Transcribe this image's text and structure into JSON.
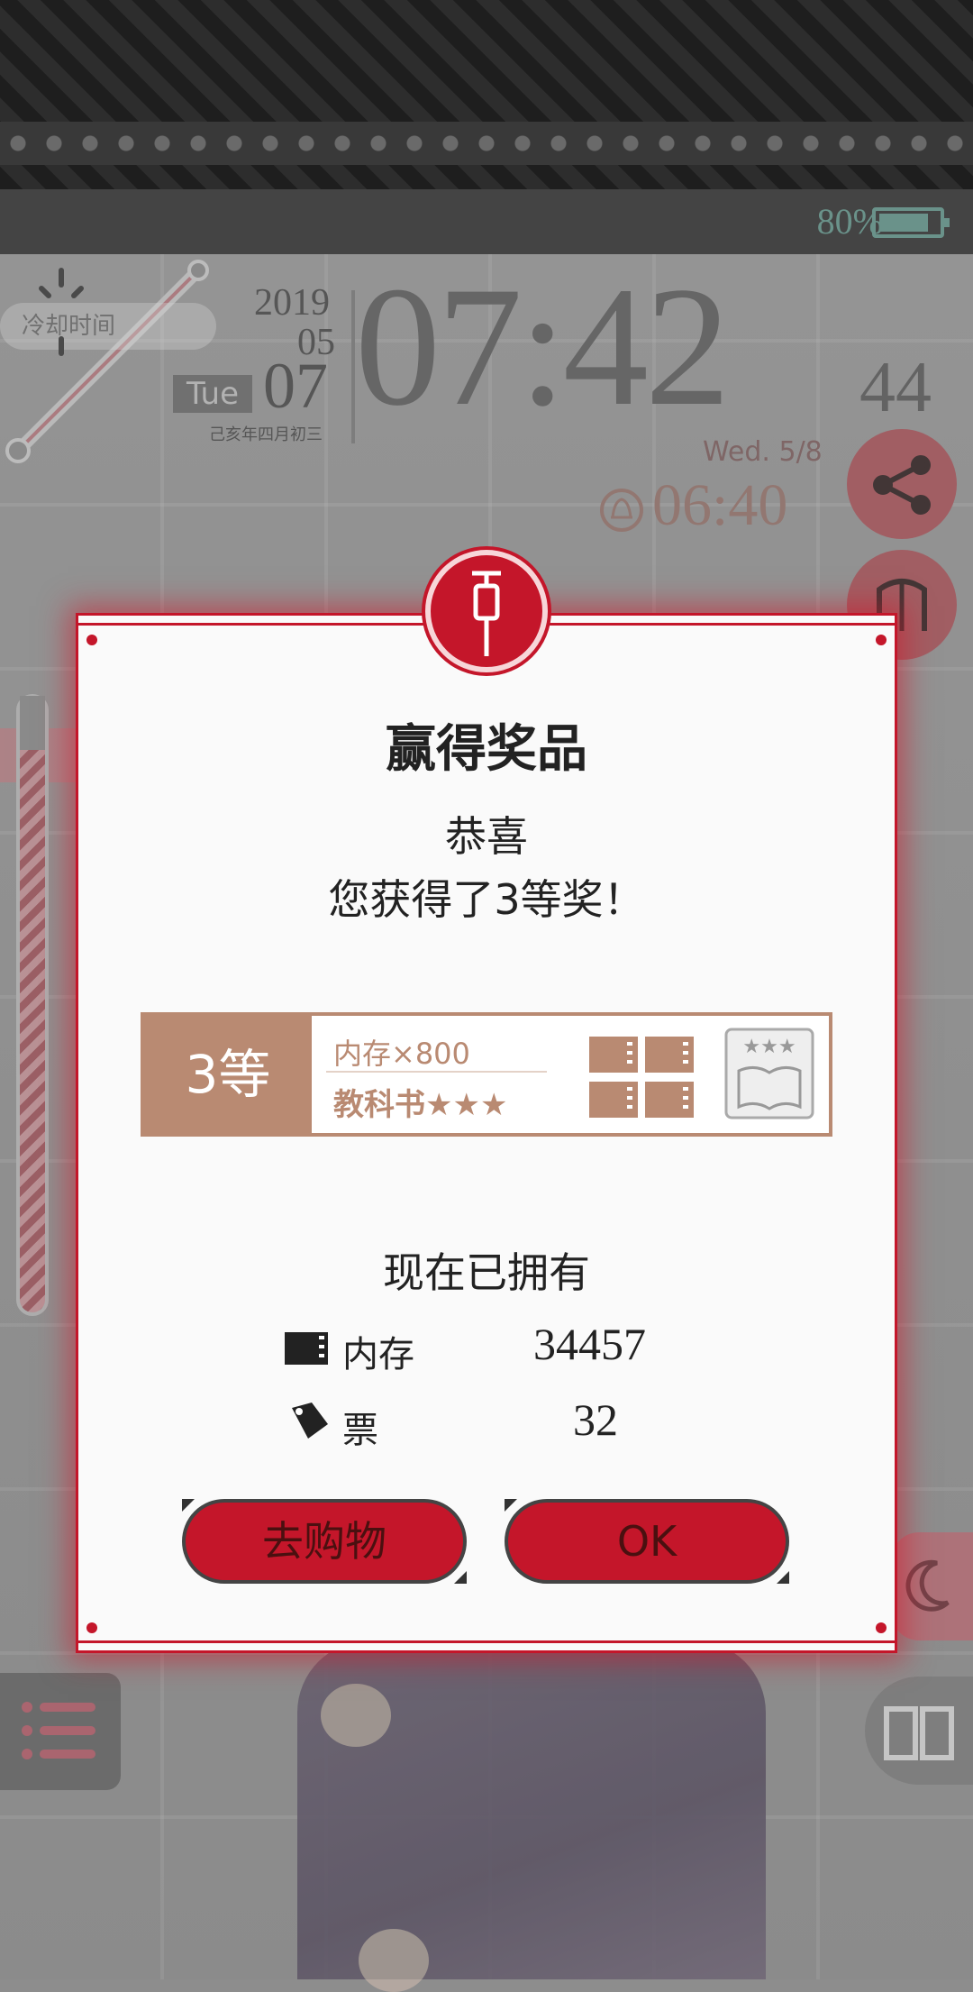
{
  "status_bar": {
    "battery_text": "80%",
    "battery_icon": "battery-icon"
  },
  "background": {
    "cooldown_label": "冷却时间",
    "date": {
      "year": "2019",
      "month": "05",
      "day": "07",
      "weekday": "Tue",
      "lunar": "己亥年四月初三"
    },
    "clock": {
      "time": "07:42",
      "seconds": "44",
      "weekday_date": "Wed.  5/8"
    },
    "alarm": {
      "time": "06:40",
      "icon": "bell-icon"
    }
  },
  "dialog": {
    "badge_icon": "syringe-icon",
    "title": "赢得奖品",
    "congrats": "恭喜",
    "result": "您获得了3等奖！",
    "prize": {
      "tier": "3等",
      "item1": "内存×800",
      "item2": "教科书★★★"
    },
    "owned_title": "现在已拥有",
    "owned": [
      {
        "icon": "memory-card-icon",
        "label": "内存",
        "value": "34457"
      },
      {
        "icon": "ticket-icon",
        "label": "票",
        "value": "32"
      }
    ],
    "buttons": {
      "shop": "去购物",
      "ok": "OK"
    }
  },
  "colors": {
    "accent": "#c4162a",
    "prize_brown": "#b98a72",
    "battery": "#6fa59a"
  }
}
